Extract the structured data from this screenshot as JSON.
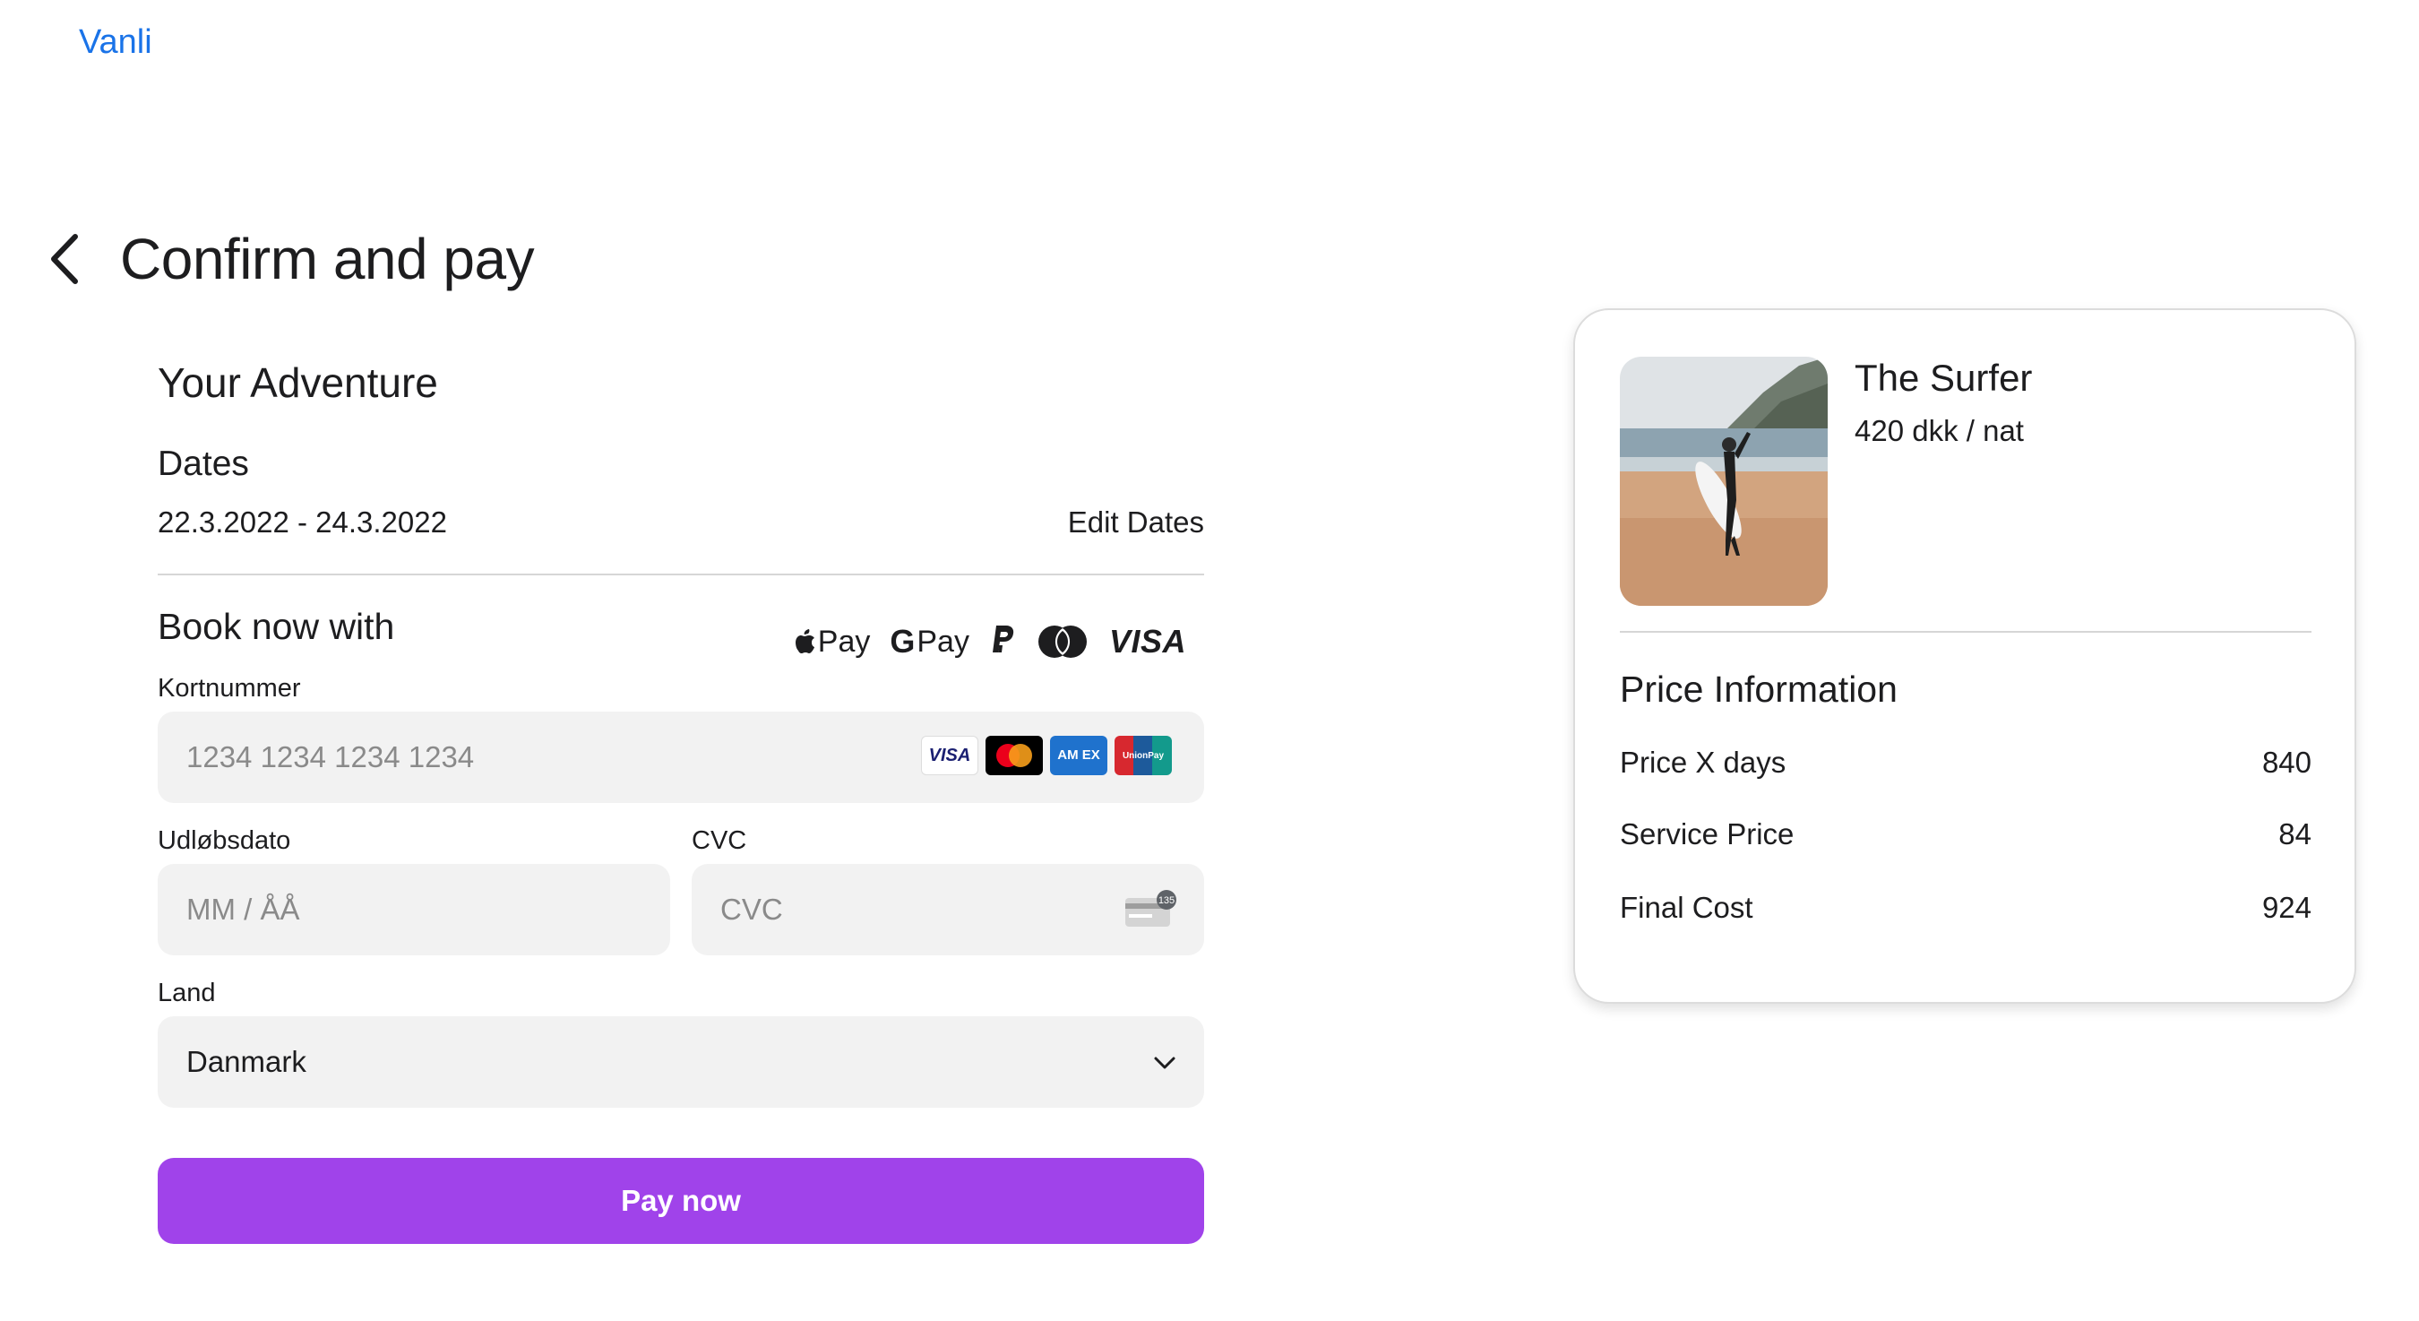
{
  "brand": "Vanli",
  "page_title": "Confirm and pay",
  "adventure": {
    "heading": "Your Adventure",
    "dates_heading": "Dates",
    "dates_value": "22.3.2022 - 24.3.2022",
    "edit_dates": "Edit Dates"
  },
  "payment": {
    "heading": "Book now with",
    "methods": {
      "apple_pay": "Pay",
      "google_pay_g": "G",
      "google_pay": "Pay",
      "visa": "VISA"
    },
    "card_number": {
      "label": "Kortnummer",
      "placeholder": "1234 1234 1234 1234"
    },
    "card_badges": {
      "visa": "VISA",
      "amex": "AM EX",
      "unionpay": "UnionPay"
    },
    "expiry": {
      "label": "Udløbsdato",
      "placeholder": "MM / ÅÅ"
    },
    "cvc": {
      "label": "CVC",
      "placeholder": "CVC",
      "icon_text": "135"
    },
    "country": {
      "label": "Land",
      "value": "Danmark"
    },
    "pay_button": "Pay now"
  },
  "summary": {
    "title": "The Surfer",
    "rate": "420 dkk / nat",
    "price_heading": "Price Information",
    "rows": [
      {
        "label": "Price X days",
        "value": "840"
      },
      {
        "label": "Service Price",
        "value": "84"
      },
      {
        "label": "Final Cost",
        "value": "924"
      }
    ]
  },
  "colors": {
    "brand_link": "#1a73e8",
    "pay_button": "#a043ea",
    "field_bg": "#f2f2f2"
  },
  "icons": [
    "back-arrow-icon",
    "apple-icon",
    "paypal-icon",
    "mastercard-icon",
    "cvc-card-icon",
    "chevron-down-icon"
  ]
}
